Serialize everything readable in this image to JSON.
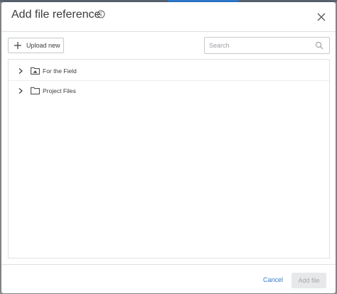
{
  "dialog": {
    "title": "Add file reference"
  },
  "toolbar": {
    "upload_label": "Upload new",
    "search_placeholder": "Search",
    "search_value": ""
  },
  "tree": {
    "items": [
      {
        "label": "For the Field",
        "icon": "shared-folder-icon"
      },
      {
        "label": "Project Files",
        "icon": "folder-icon"
      }
    ]
  },
  "footer": {
    "cancel_label": "Cancel",
    "add_label": "Add file"
  },
  "colors": {
    "accent": "#2d7bd1",
    "text": "#3c3c3c",
    "border": "#dfe1e4",
    "disabled_bg": "#e7e8ea"
  }
}
